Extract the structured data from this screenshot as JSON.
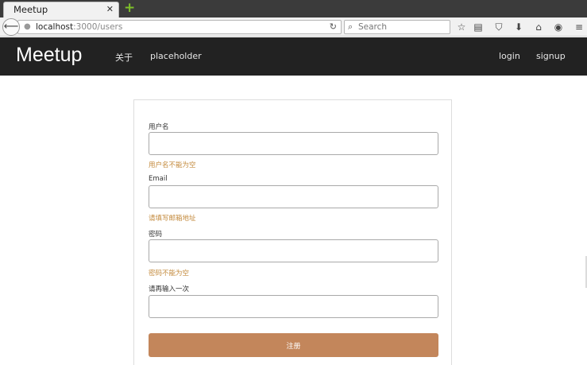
{
  "browser": {
    "tab_title": "Meetup",
    "tab_close": "✕",
    "new_tab": "+",
    "back": "⟵",
    "url_host": "localhost",
    "url_path": ":3000/users",
    "reload": "↻",
    "search_placeholder": "Search",
    "toolbar_icons": [
      "☆",
      "▤",
      "⛉",
      "⬇",
      "⌂",
      "◉",
      "≡"
    ]
  },
  "navbar": {
    "brand": "Meetup",
    "links": [
      "关于",
      "placeholder"
    ],
    "right_links": [
      "login",
      "signup"
    ]
  },
  "form": {
    "fields": [
      {
        "label": "用户名",
        "value": "",
        "error": "用户名不能为空"
      },
      {
        "label": "Email",
        "value": "",
        "error": "请填写邮箱地址"
      },
      {
        "label": "密码",
        "value": "",
        "error": "密码不能为空"
      },
      {
        "label": "请再输入一次",
        "value": "",
        "error": ""
      }
    ],
    "submit_label": "注册"
  }
}
